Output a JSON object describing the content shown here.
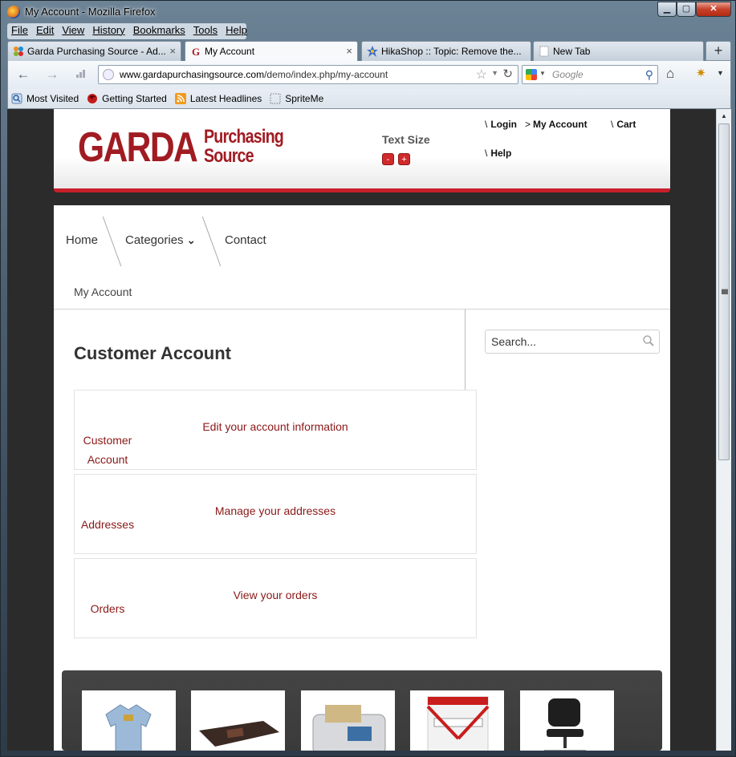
{
  "window": {
    "title": "My Account - Mozilla Firefox",
    "controls": {
      "minimize": "▁",
      "maximize": "▢",
      "close": "✕"
    }
  },
  "menu": [
    "File",
    "Edit",
    "View",
    "History",
    "Bookmarks",
    "Tools",
    "Help"
  ],
  "tabs": [
    {
      "label": "Garda Purchasing Source - Ad...",
      "icon": "joomla-icon",
      "active": false
    },
    {
      "label": "My Account",
      "icon": "garda-g-icon",
      "active": true
    },
    {
      "label": "HikaShop :: Topic: Remove the...",
      "icon": "hikashop-icon",
      "active": false
    },
    {
      "label": "New Tab",
      "icon": "blank-page-icon",
      "active": false
    }
  ],
  "tab_close": "×",
  "new_tab": "+",
  "address": {
    "domain": "www.gardapurchasingsource.com",
    "path": "/demo/index.php/my-account"
  },
  "browser_search": {
    "placeholder": "Google"
  },
  "bookmarks": [
    {
      "label": "Most Visited",
      "icon": "most-visited-icon"
    },
    {
      "label": "Getting Started",
      "icon": "firefox-red-icon"
    },
    {
      "label": "Latest Headlines",
      "icon": "rss-icon"
    },
    {
      "label": "SpriteMe",
      "icon": "dotted-square-icon"
    }
  ],
  "site": {
    "logo": {
      "word1": "GARDA",
      "word2": "Purchasing",
      "word3": "Source"
    },
    "text_size": {
      "label": "Text Size",
      "minus": "-",
      "plus": "+"
    },
    "top_links": [
      {
        "prefix": "\\",
        "label": "Login"
      },
      {
        "prefix": ">",
        "label": "My Account"
      },
      {
        "prefix": "\\",
        "label": "Cart"
      },
      {
        "prefix": "\\",
        "label": "Help"
      }
    ],
    "nav": [
      {
        "label": "Home"
      },
      {
        "label": "Categories",
        "caret": "⌄"
      },
      {
        "label": "Contact"
      }
    ],
    "breadcrumb": "My Account",
    "page_title": "Customer Account",
    "search_placeholder": "Search...",
    "cards": [
      {
        "label_line1": "Customer",
        "label_line2": "Account",
        "link": "Edit your account information"
      },
      {
        "label_line1": "Addresses",
        "label_line2": "",
        "link": "Manage your addresses"
      },
      {
        "label_line1": "Orders",
        "label_line2": "",
        "link": "View your orders"
      }
    ]
  },
  "colors": {
    "brand_red": "#a11b22",
    "link_red": "#8b1818",
    "header_bar": "#c8202a"
  }
}
